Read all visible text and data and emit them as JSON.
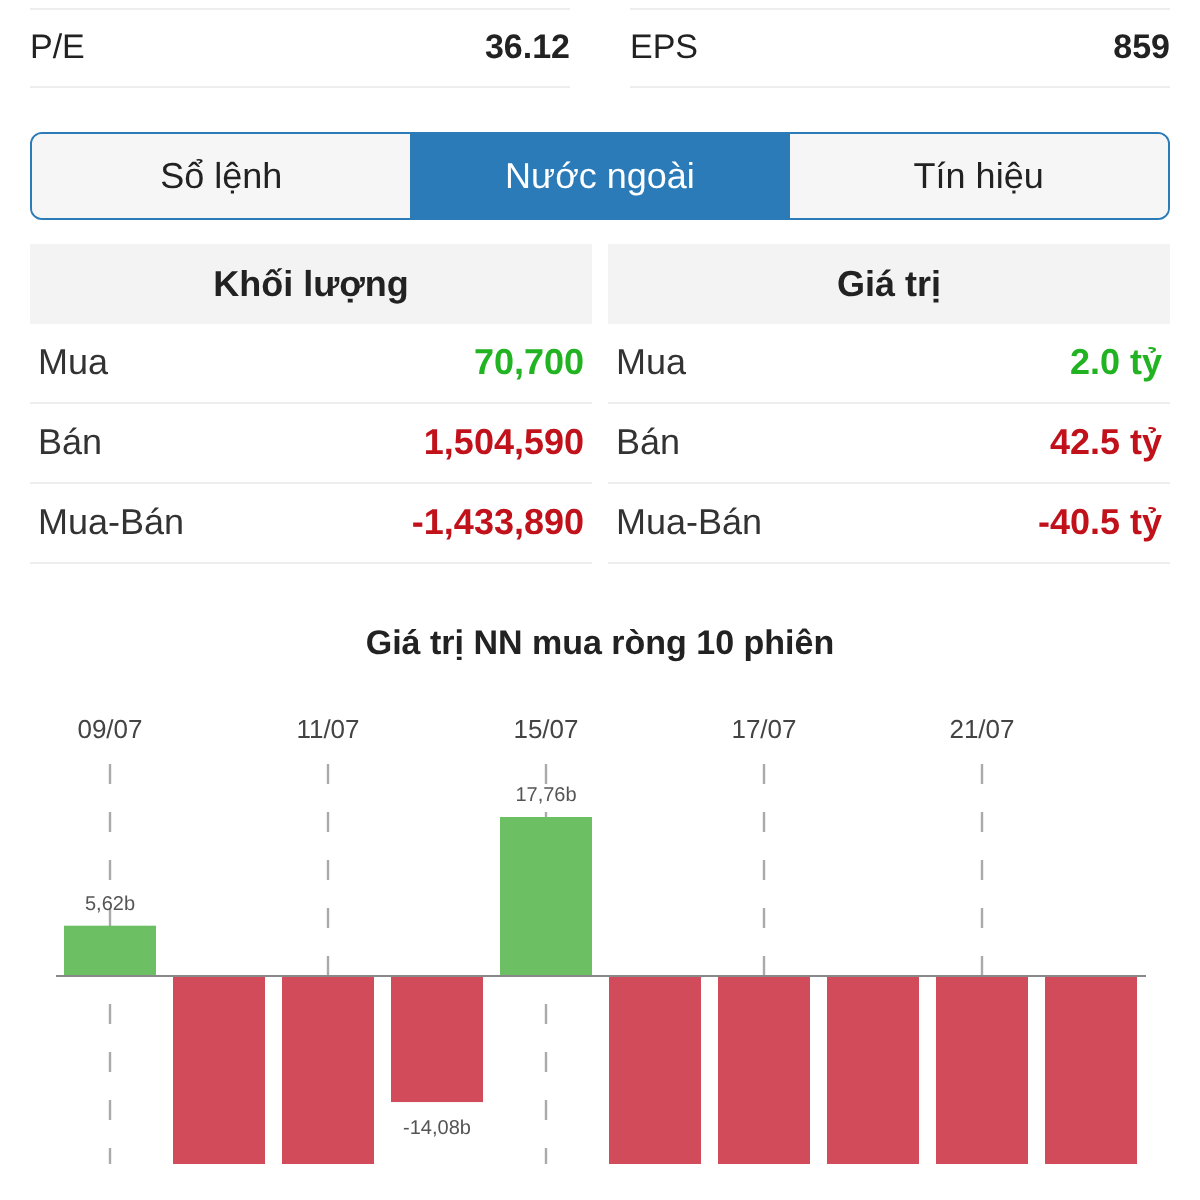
{
  "stats": [
    {
      "label": "P/E",
      "value": "36.12"
    },
    {
      "label": "EPS",
      "value": "859"
    }
  ],
  "tabs": [
    {
      "label": "Sổ lệnh",
      "selected": false
    },
    {
      "label": "Nước ngoài",
      "selected": true
    },
    {
      "label": "Tín hiệu",
      "selected": false
    }
  ],
  "tables": [
    {
      "header": "Khối lượng",
      "rows": [
        {
          "label": "Mua",
          "value": "70,700",
          "color": "#22b322"
        },
        {
          "label": "Bán",
          "value": "1,504,590",
          "color": "#c1121c"
        },
        {
          "label": "Mua-Bán",
          "value": "-1,433,890",
          "color": "#c1121c"
        }
      ]
    },
    {
      "header": "Giá trị",
      "rows": [
        {
          "label": "Mua",
          "value": "2.0 tỷ",
          "color": "#22b322"
        },
        {
          "label": "Bán",
          "value": "42.5 tỷ",
          "color": "#c1121c"
        },
        {
          "label": "Mua-Bán",
          "value": "-40.5 tỷ",
          "color": "#c1121c"
        }
      ]
    }
  ],
  "chart": {
    "chart_data": {
      "type": "bar",
      "title": "Giá trị NN mua ròng 10 phiên",
      "grid": true,
      "categories": [
        "09/07",
        null,
        "11/07",
        null,
        "15/07",
        null,
        "17/07",
        null,
        "21/07",
        null
      ],
      "values": [
        5.62,
        -21,
        -21,
        -14.08,
        17.76,
        -21,
        -21,
        -21,
        -21,
        -21
      ],
      "value_labels": [
        "5,62b",
        null,
        null,
        "-14,08b",
        "17,76b",
        null,
        null,
        null,
        null,
        null
      ]
    }
  }
}
